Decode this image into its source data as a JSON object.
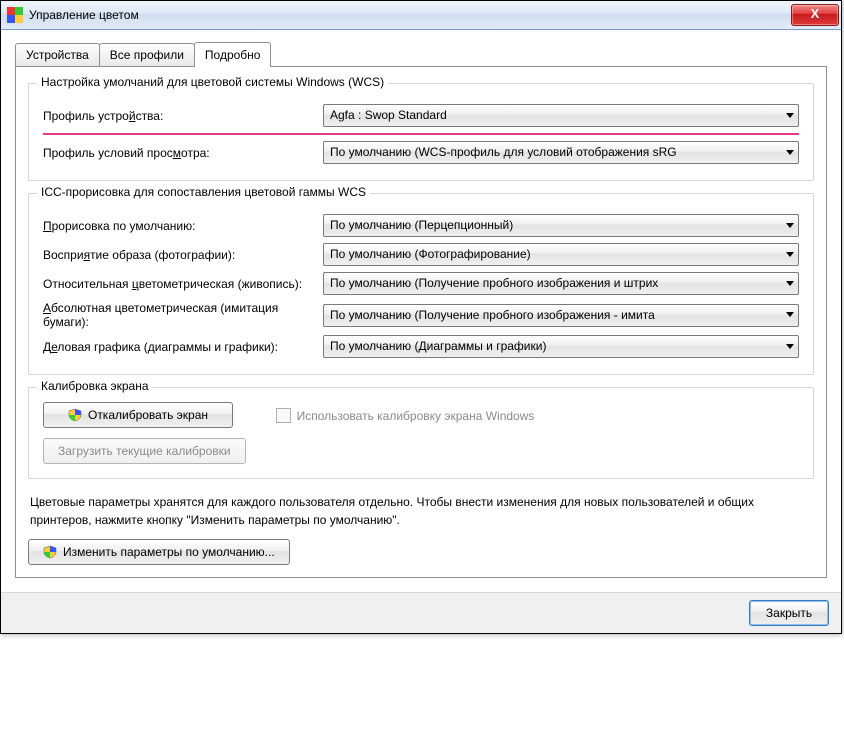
{
  "window": {
    "title": "Управление цветом"
  },
  "tabs": {
    "devices": "Устройства",
    "all_profiles": "Все профили",
    "advanced": "Подробно"
  },
  "group_wcs": {
    "title": "Настройка умолчаний для цветовой системы Windows (WCS)",
    "device_profile_label_pre": "Профиль устро",
    "device_profile_label_ul": "й",
    "device_profile_label_post": "ства:",
    "device_profile_value": "Agfa : Swop Standard",
    "viewing_profile_label_pre": "Профиль условий прос",
    "viewing_profile_label_ul": "м",
    "viewing_profile_label_post": "отра:",
    "viewing_profile_value": "По умолчанию (WCS-профиль для условий отображения sRG"
  },
  "group_icc": {
    "title": "ICC-прорисовка для сопоставления цветовой гаммы WCS",
    "default_render_ul": "П",
    "default_render_post": "рорисовка по умолчанию:",
    "default_render_value": "По умолчанию (Перцепционный)",
    "percep_pre": "Воспри",
    "percep_ul": "я",
    "percep_post": "тие образа (фотографии):",
    "percep_value": "По умолчанию (Фотографирование)",
    "rel_pre": "Относительная ",
    "rel_ul": "ц",
    "rel_post": "ветометрическая (живопись):",
    "rel_value": "По умолчанию (Получение пробного изображения и штрих",
    "abs_ul": "А",
    "abs_post": "бсолютная цветометрическая (имитация бумаги):",
    "abs_value": "По умолчанию (Получение пробного изображения - имита",
    "biz_pre": "Д",
    "biz_ul": "е",
    "biz_post": "ловая графика (диаграммы и графики):",
    "biz_value": "По умолчанию (Диаграммы и графики)"
  },
  "group_cal": {
    "title": "Калибровка экрана",
    "calibrate_btn_ul": "О",
    "calibrate_btn_post": "ткалибровать экран",
    "load_btn_pre": "За",
    "load_btn_ul": "г",
    "load_btn_post": "рузить текущие калибровки",
    "use_win_pre": "И",
    "use_win_ul": "с",
    "use_win_post": "пользовать калибровку экрана Windows"
  },
  "info_text": "Цветовые параметры хранятся для каждого пользователя отдельно. Чтобы внести изменения для новых пользователей и общих принтеров, нажмите кнопку \"Изменить параметры по умолчанию\".",
  "change_defaults_btn_ul": "И",
  "change_defaults_btn_post": "зменить параметры по умолчанию...",
  "close_btn": "Закрыть"
}
